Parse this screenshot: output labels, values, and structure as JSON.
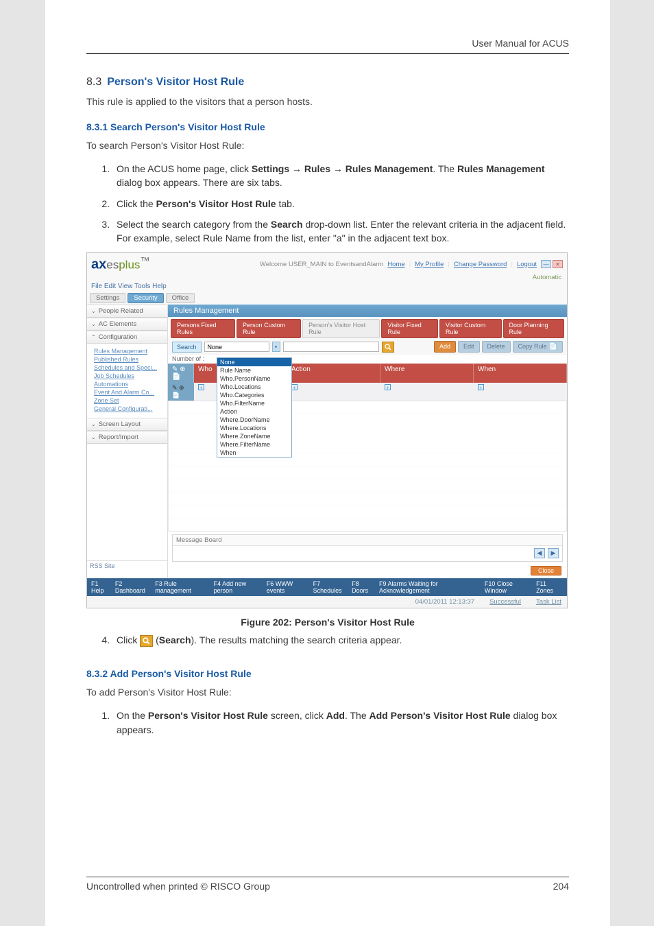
{
  "header": {
    "title": "User Manual for ACUS"
  },
  "section": {
    "number": "8.3",
    "title": "Person's Visitor Host Rule",
    "intro": "This rule is applied to the visitors that a person hosts."
  },
  "sub1": {
    "number": "8.3.1",
    "title": "Search Person's Visitor Host Rule",
    "intro": "To search Person's Visitor Host Rule:",
    "steps": {
      "s1a": "On the ACUS home page, click ",
      "s1_settings": "Settings",
      "s1_arrow1": " → ",
      "s1_rules": "Rules",
      "s1_arrow2": " → ",
      "s1_rm": "Rules Management",
      "s1b": ". The ",
      "s1_rmbold": "Rules Management",
      "s1c": " dialog box appears. There are six tabs.",
      "s2a": "Click the ",
      "s2b": "Person's Visitor Host Rule",
      "s2c": " tab.",
      "s3a": "Select the search category from the ",
      "s3b": "Search",
      "s3c": " drop-down list. Enter the relevant criteria in the adjacent field. For example, select Rule Name from the list, enter \"a\" in the adjacent text box.",
      "s4a": "Click ",
      "s4b": "Search",
      "s4c": "). The results matching the search criteria appear."
    }
  },
  "app": {
    "logo_a": "ax",
    "logo_b": "es",
    "logo_c": "plus",
    "logo_tm": "™",
    "welcome": "Welcome USER_MAIN to EventsandAlarm",
    "home": "Home",
    "myprofile": "My Profile",
    "changepw": "Change Password",
    "logout": "Logout",
    "mode": "Automatic",
    "menubar": "File  Edit  View  Tools  Help",
    "toolbar": {
      "settings": "Settings",
      "security": "Security",
      "office": "Office"
    },
    "sidebar": {
      "people": "People Related",
      "ac": "AC Elements",
      "config": "Configuration",
      "links": [
        "Rules Management",
        "Published Rules",
        "Schedules and Speci...",
        "Job Schedules",
        "Automations",
        "Event And Alarm Co...",
        "Zone Set",
        "General Configurati..."
      ],
      "screen": "Screen Layout",
      "report": "Report/Import",
      "rss": "RSS Site"
    },
    "win": {
      "title": "Rules Management",
      "tabs": [
        "Persons Fixed Rules",
        "Person Custom Rule",
        "Person's Visitor Host Rule",
        "Visitor Fixed Rule",
        "Visitor Custom Rule",
        "Door Planning Rule"
      ],
      "search_label": "Search",
      "search_value": "None",
      "dropdown_sel": "None",
      "dropdown": [
        "Rule Name",
        "Who.PersonName",
        "Who.Locations",
        "Who.Categories",
        "Who.FilterName",
        "Action",
        "Where.DoorName",
        "Where.Locations",
        "Where.ZoneName",
        "Where.FilterName",
        "When"
      ],
      "numberof": "Number of :",
      "btns": {
        "add": "Add",
        "edit": "Edit",
        "delete": "Delete",
        "copyrule": "Copy Rule"
      },
      "cols": [
        "Who",
        "Action",
        "Where",
        "When"
      ],
      "msg": "Message Board",
      "close": "Close",
      "fkeys": [
        "F1 Help",
        "F2 Dashboard",
        "F3 Rule management",
        "F4 Add new person",
        "F6 WWW events",
        "F7 Schedules",
        "F8 Doors",
        "F9 Alarms Waiting for Acknowledgement",
        "F10 Close Window",
        "F11 Zones"
      ],
      "status_time": "04/01/2011 12:13:37",
      "status_succ": "Successful",
      "status_task": "Task List"
    }
  },
  "figcaption": "Figure 202: Person's Visitor Host Rule",
  "sub2": {
    "number": "8.3.2",
    "title": "Add Person's Visitor Host Rule",
    "intro": "To add Person's Visitor Host Rule:",
    "s1a": "On the ",
    "s1b": "Person's Visitor Host Rule",
    "s1c": " screen, click ",
    "s1d": "Add",
    "s1e": ". The ",
    "s1f": "Add Person's Visitor Host Rule",
    "s1g": " dialog box appears."
  },
  "footer": {
    "left": "Uncontrolled when printed © RISCO Group",
    "right": "204"
  }
}
